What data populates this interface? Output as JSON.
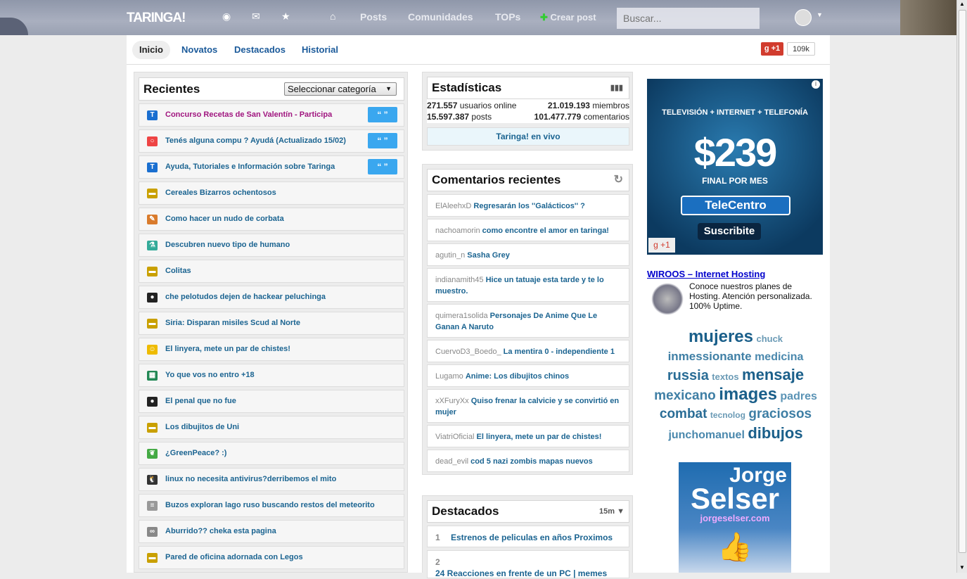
{
  "header": {
    "logo": "TARINGA!",
    "nav": [
      "Posts",
      "Comunidades",
      "TOPs"
    ],
    "create": "Crear post",
    "search_placeholder": "Buscar..."
  },
  "subnav": {
    "tabs": [
      "Inicio",
      "Novatos",
      "Destacados",
      "Historial"
    ],
    "gplus": "+1",
    "gplus_count": "109k"
  },
  "recientes": {
    "title": "Recientes",
    "select": "Seleccionar categoría",
    "quote": "“ ”",
    "items": [
      {
        "icon": "taringa-icon",
        "title": "Concurso Recetas de San Valentín - Participa",
        "color": "#a0157f",
        "sticky": true
      },
      {
        "icon": "lifebuoy-icon",
        "title": "Tenés alguna compu ? Ayudá (Actualizado 15/02)",
        "sticky": true
      },
      {
        "icon": "taringa-icon",
        "title": "Ayuda, Tutoriales e Información sobre Taringa",
        "sticky": true
      },
      {
        "icon": "image-icon",
        "title": "Cereales Bizarros ochentosos"
      },
      {
        "icon": "howto-icon",
        "title": "Como hacer un nudo de corbata"
      },
      {
        "icon": "science-icon",
        "title": "Descubren nuevo tipo de humano"
      },
      {
        "icon": "image-icon",
        "title": "Colitas"
      },
      {
        "icon": "soccer-icon",
        "title": "che pelotudos dejen de hackear peluchinga"
      },
      {
        "icon": "image-icon",
        "title": "Siria: Disparan misiles Scud al Norte"
      },
      {
        "icon": "humor-icon",
        "title": "El linyera, mete un par de chistes!"
      },
      {
        "icon": "film-icon",
        "title": "Yo que vos no entro +18"
      },
      {
        "icon": "soccer-icon",
        "title": "El penal que no fue"
      },
      {
        "icon": "image-icon",
        "title": "Los dibujitos de Uni"
      },
      {
        "icon": "leaf-icon",
        "title": "¿GreenPeace? :)"
      },
      {
        "icon": "linux-icon",
        "title": "linux no necesita antivirus?derribemos el mito"
      },
      {
        "icon": "news-icon",
        "title": "Buzos exploran lago ruso buscando restos del meteorito"
      },
      {
        "icon": "link-icon",
        "title": "Aburrido?? cheka esta pagina"
      },
      {
        "icon": "image-icon",
        "title": "Pared de oficina adornada con Legos"
      }
    ]
  },
  "stats": {
    "title": "Estadísticas",
    "online": "271.557",
    "online_label": "usuarios online",
    "members": "21.019.193",
    "members_label": "miembros",
    "posts": "15.597.387",
    "posts_label": "posts",
    "comments": "101.477.779",
    "comments_label": "comentarios",
    "live": "Taringa! en vivo"
  },
  "comments": {
    "title": "Comentarios recientes",
    "items": [
      {
        "user": "ElAleehxD",
        "post": "Regresarán los ''Galácticos'' ?"
      },
      {
        "user": "nachoamorin",
        "post": "como encontre el amor en taringa!"
      },
      {
        "user": "agutin_n",
        "post": "Sasha Grey"
      },
      {
        "user": "indianamith45",
        "post": "Hice un tatuaje esta tarde y te lo muestro."
      },
      {
        "user": "quimera1solida",
        "post": "Personajes De Anime Que Le Ganan A Naruto"
      },
      {
        "user": "CuervoD3_Boedo_",
        "post": "La mentira 0 - independiente 1"
      },
      {
        "user": "Lugamo",
        "post": "Anime: Los dibujitos chinos"
      },
      {
        "user": "xXFuryXx",
        "post": "Quiso frenar la calvicie y se convirtió en mujer"
      },
      {
        "user": "ViatriOficial",
        "post": "El linyera, mete un par de chistes!"
      },
      {
        "user": "dead_evil",
        "post": "cod 5 nazi zombis mapas nuevos"
      }
    ]
  },
  "destacados": {
    "title": "Destacados",
    "period": "15m",
    "items": [
      {
        "n": "1",
        "title": "Estrenos de peliculas en años Proximos"
      },
      {
        "n": "2",
        "title": "24 Reacciones en frente de un PC | memes"
      }
    ]
  },
  "ad1": {
    "line": "TELEVISIÓN + INTERNET + TELEFONÍA",
    "price": "$239",
    "sub": "FINAL POR MES",
    "brand": "TeleCentro",
    "cta": "Suscribite",
    "gplus": "+1"
  },
  "ad2": {
    "title": "WIROOS – Internet Hosting",
    "text": "Conoce nuestros planes de Hosting. Atención personalizada. 100% Uptime."
  },
  "tags": [
    [
      "mujeres",
      24,
      "#1a5f8a"
    ],
    [
      "chuck",
      13,
      "#6a9ab5"
    ],
    [
      "inmessionante",
      17,
      "#3f7fa5"
    ],
    [
      "medicina",
      16,
      "#4a88ad"
    ],
    [
      "russia",
      20,
      "#2a6d96"
    ],
    [
      "textos",
      13,
      "#6a9ab5"
    ],
    [
      "mensaje",
      22,
      "#1a5f8a"
    ],
    [
      "mexicano",
      19,
      "#3f7fa5"
    ],
    [
      "images",
      24,
      "#1a5f8a"
    ],
    [
      "padres",
      16,
      "#5a93b5"
    ],
    [
      "combat",
      19,
      "#2a6d96"
    ],
    [
      "tecnolog",
      12,
      "#6a9ab5"
    ],
    [
      "graciosos",
      19,
      "#3f7fa5"
    ],
    [
      "junchomanuel",
      16,
      "#4a88ad"
    ],
    [
      "dibujos",
      22,
      "#1a5f8a"
    ]
  ],
  "ad3": {
    "name1": "Jorge",
    "name2": "Selser",
    "url": "jorgeselser.com"
  }
}
